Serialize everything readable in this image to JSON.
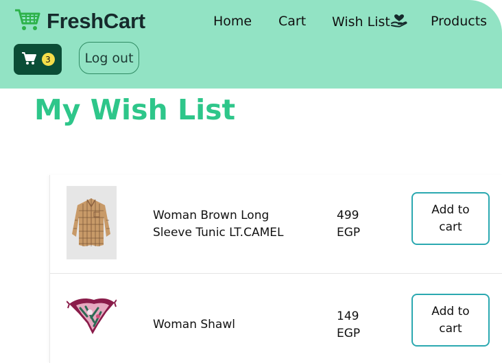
{
  "brand": {
    "name": "FreshCart",
    "icon": "shopping-cart-icon",
    "color": "#2ec68a"
  },
  "nav": {
    "links": [
      "Home",
      "Cart",
      "Wish List",
      "Products"
    ],
    "wishlist_icon": "hand-heart-icon"
  },
  "cart": {
    "count": "3",
    "icon": "cart-icon"
  },
  "auth": {
    "logout_label": "Log out"
  },
  "page": {
    "title": "My Wish List"
  },
  "wishlist": {
    "items": [
      {
        "name": "Woman Brown Long Sleeve Tunic LT.CAMEL",
        "price": "499 EGP",
        "button": "Add to cart",
        "image": "brown-plaid-tunic"
      },
      {
        "name": "Woman Shawl",
        "price": "149 EGP",
        "button": "Add to cart",
        "image": "printed-silk-shawl"
      }
    ]
  },
  "colors": {
    "navbar": "#92e3c4",
    "title": "#2ec68a",
    "cart_button": "#0b4d36",
    "badge": "#f5dd4a"
  }
}
